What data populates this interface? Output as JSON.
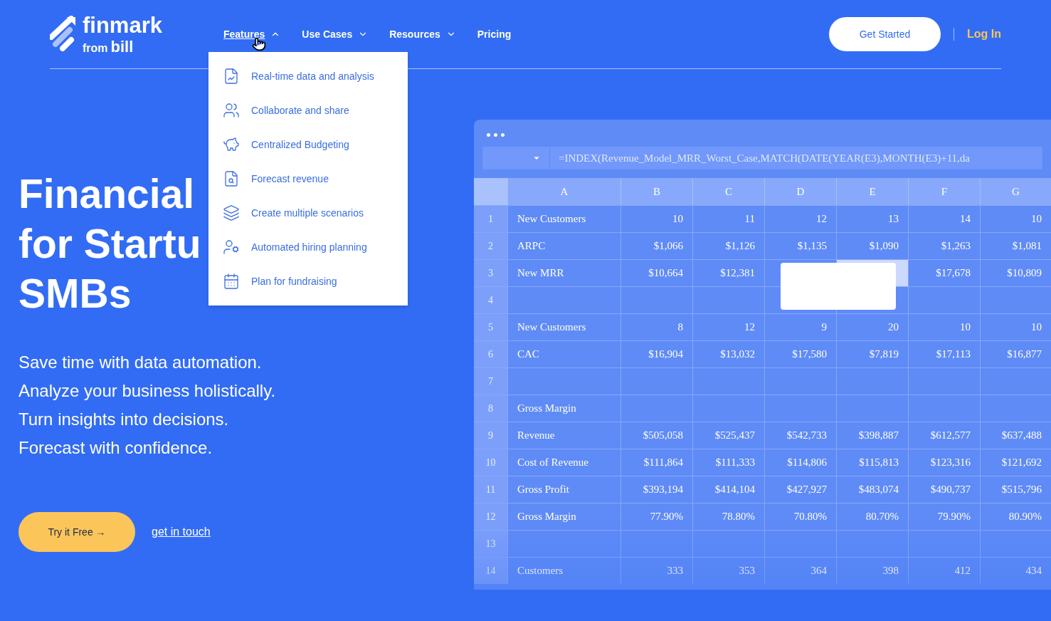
{
  "logo": {
    "name": "finmark",
    "from": "from",
    "brand": "bill"
  },
  "nav": [
    {
      "label": "Features",
      "has_menu": true,
      "expanded": true
    },
    {
      "label": "Use Cases",
      "has_menu": true,
      "expanded": false
    },
    {
      "label": "Resources",
      "has_menu": true,
      "expanded": false
    },
    {
      "label": "Pricing",
      "has_menu": false,
      "expanded": false
    }
  ],
  "actions": {
    "get_started": "Get Started",
    "log_in": "Log In"
  },
  "features_menu": [
    "Real-time data and analysis",
    "Collaborate and share",
    "Centralized Budgeting",
    "Forecast revenue",
    "Create multiple scenarios",
    "Automated hiring planning",
    "Plan for fundraising"
  ],
  "hero": {
    "heading_lines": [
      "Financial",
      "for Startu",
      "SMBs"
    ],
    "taglines": [
      "Save time with data automation.",
      "Analyze your business holistically.",
      "Turn insights into decisions.",
      "Forecast with confidence."
    ],
    "try_button": "Try it Free →",
    "contact_link": "get in touch"
  },
  "spreadsheet": {
    "formula": "=INDEX(Revenue_Model_MRR_Worst_Case,MATCH(DATE(YEAR(E3),MONTH(E3)+11,da",
    "columns": [
      "A",
      "B",
      "C",
      "D",
      "E",
      "F",
      "G"
    ],
    "rows": [
      {
        "num": "1",
        "label": "New Customers",
        "values": [
          "10",
          "11",
          "12",
          "13",
          "14",
          "10"
        ]
      },
      {
        "num": "2",
        "label": "ARPC",
        "values": [
          "$1,066",
          "$1,126",
          "$1,135",
          "$1,090",
          "$1,263",
          "$1,081"
        ]
      },
      {
        "num": "3",
        "label": "New MRR",
        "cells": [
          {
            "text": "$10,664",
            "selected": false
          },
          {
            "text": "$12,381",
            "selected": false
          },
          {
            "selected": false
          },
          {
            "selected": true
          },
          {
            "text": "$17,678",
            "selected": false
          },
          {
            "text": "$10,809",
            "selected": false
          }
        ]
      },
      {
        "num": "4"
      },
      {
        "num": "5",
        "label": "New Customers",
        "values": [
          "8",
          "12",
          "9",
          "20",
          "10",
          "10"
        ]
      },
      {
        "num": "6",
        "label": "CAC",
        "values": [
          "$16,904",
          "$13,032",
          "$17,580",
          "$7,819",
          "$17,113",
          "$16,877"
        ]
      },
      {
        "num": "7"
      },
      {
        "num": "8",
        "label": "Gross Margin"
      },
      {
        "num": "9",
        "label": "Revenue",
        "values": [
          "$505,058",
          "$525,437",
          "$542,733",
          "$398,887",
          "$612,577",
          "$637,488"
        ]
      },
      {
        "num": "10",
        "label": "Cost of Revenue",
        "values": [
          "$111,864",
          "$111,333",
          "$114,806",
          "$115,813",
          "$123,316",
          "$121,692"
        ]
      },
      {
        "num": "11",
        "label": "Gross Profit",
        "values": [
          "$393,194",
          "$414,104",
          "$427,927",
          "$483,074",
          "$490,737",
          "$515,796"
        ]
      },
      {
        "num": "12",
        "label": "Gross Margin",
        "values": [
          "77.90%",
          "78.80%",
          "70.80%",
          "80.70%",
          "79.90%",
          "80.90%"
        ]
      },
      {
        "num": "13"
      },
      {
        "num": "14",
        "label": "Customers",
        "values": [
          "333",
          "353",
          "364",
          "398",
          "412",
          "434"
        ]
      }
    ]
  }
}
